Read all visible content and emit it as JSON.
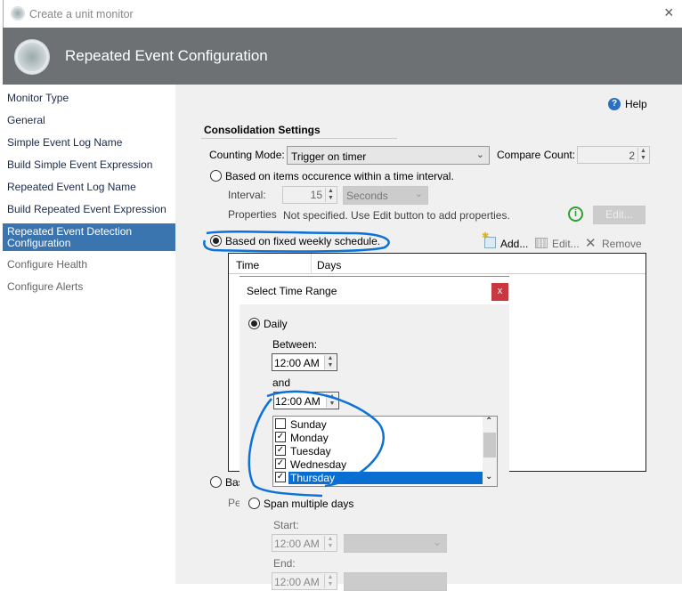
{
  "window": {
    "title": "Create a unit monitor",
    "close": "×"
  },
  "header": {
    "title": "Repeated Event Configuration"
  },
  "sidebar": {
    "items": [
      {
        "label": "Monitor Type"
      },
      {
        "label": "General"
      },
      {
        "label": "Simple Event Log Name"
      },
      {
        "label": "Build Simple Event Expression"
      },
      {
        "label": "Repeated Event Log Name"
      },
      {
        "label": "Build Repeated Event Expression"
      },
      {
        "label": "Repeated Event Detection Configuration",
        "selected": true
      },
      {
        "label": "Configure Health"
      },
      {
        "label": "Configure Alerts"
      }
    ]
  },
  "main": {
    "help": "Help",
    "section_title": "Consolidation Settings",
    "counting_mode_label": "Counting Mode:",
    "counting_mode_value": "Trigger on timer",
    "compare_count_label": "Compare Count:",
    "compare_count_value": "2",
    "radio_interval": "Based on items occurence within a time interval.",
    "interval_label": "Interval:",
    "interval_value": "15",
    "interval_unit": "Seconds",
    "properties_label": "Properties",
    "properties_text": "Not specified. Use Edit button to add properties.",
    "edit_button": "Edit...",
    "radio_weekly": "Based on fixed weekly schedule.",
    "toolbar": {
      "add": "Add...",
      "edit": "Edit...",
      "remove": "Remove"
    },
    "table": {
      "columns": [
        "Time",
        "Days"
      ]
    },
    "radio_hidden": "Bas",
    "hidden_label": "Per"
  },
  "dialog": {
    "title": "Select Time Range",
    "close": "x",
    "daily": "Daily",
    "between": "Between:",
    "start_time": "12:00 AM",
    "and": "and",
    "end_time": "12:00 AM",
    "days": [
      {
        "label": "Sunday",
        "checked": false
      },
      {
        "label": "Monday",
        "checked": true
      },
      {
        "label": "Tuesday",
        "checked": true
      },
      {
        "label": "Wednesday",
        "checked": true
      },
      {
        "label": "Thursday",
        "checked": true,
        "selected": true
      }
    ],
    "span": "Span multiple days",
    "start_label": "Start:",
    "span_start": "12:00 AM",
    "end_label": "End:",
    "span_end": "12:00 AM"
  },
  "colors": {
    "accent": "#3a75b0",
    "selection": "#0a6ed1",
    "annotation": "#0a72d8",
    "close": "#c9383e"
  }
}
